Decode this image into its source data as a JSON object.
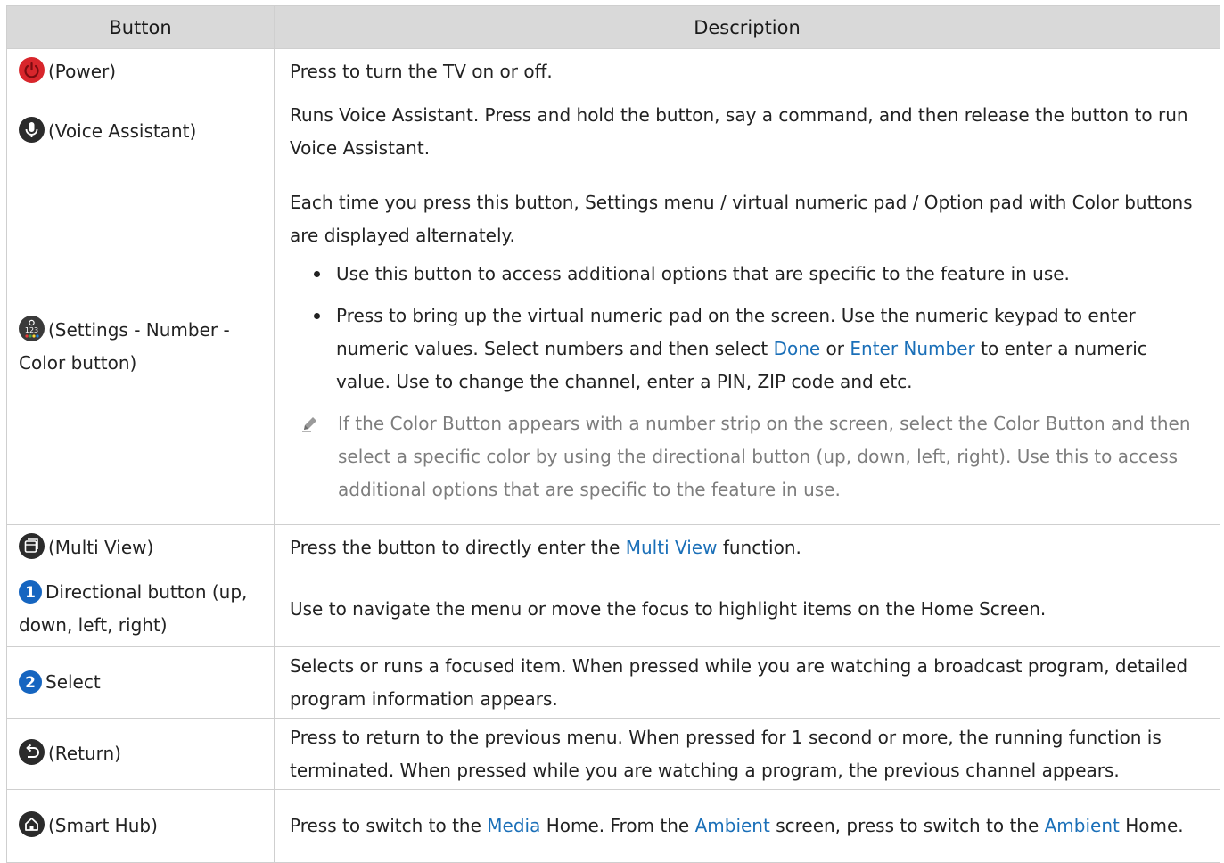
{
  "header": {
    "col_button": "Button",
    "col_description": "Description"
  },
  "rows": [
    {
      "button": "(Power)",
      "icon": "power-icon",
      "desc": "Press to turn the TV on or off."
    },
    {
      "button": "(Voice Assistant)",
      "icon": "microphone-icon",
      "desc": "Runs Voice Assistant. Press and hold the button, say a command, and then release the button to run Voice Assistant."
    },
    {
      "button": "(Settings - Number - Color button)",
      "icon": "settings-number-color-icon",
      "desc": "Each time you press this button, Settings menu / virtual numeric pad / Option pad with Color buttons are displayed alternately.",
      "bullet1": "Use this button to access additional options that are specific to the feature in use.",
      "bullet2_a": "Press to bring up the virtual numeric pad on the screen. Use the numeric keypad to enter numeric values. Select numbers and then select",
      "bullet2_link1": "Done",
      "bullet2_b": "or",
      "bullet2_link2": "Enter Number",
      "bullet2_c": "to enter a numeric value. Use to change the channel, enter a PIN, ZIP code and etc.",
      "note": "If the Color Button appears with a number strip on the screen, select the Color Button and then select a specific color by using the directional button (up, down, left, right). Use this to access additional options that are specific to the feature in use."
    },
    {
      "button": "(Multi View)",
      "icon": "multi-view-icon",
      "desc_a": "Press the button to directly enter the",
      "desc_link": "Multi View",
      "desc_b": "function."
    },
    {
      "badge": "1",
      "button": "Directional button (up, down, left, right)",
      "desc": "Use to navigate the menu or move the focus to highlight items on the Home Screen."
    },
    {
      "badge": "2",
      "button": "Select",
      "desc": "Selects or runs a focused item. When pressed while you are watching a broadcast program, detailed program information appears."
    },
    {
      "button": "(Return)",
      "icon": "return-icon",
      "desc": "Press to return to the previous menu. When pressed for 1 second or more, the running function is terminated. When pressed while you are watching a program, the previous channel appears."
    },
    {
      "button": "(Smart Hub)",
      "icon": "home-icon",
      "desc_a": "Press to switch to the",
      "desc_link1": "Media",
      "desc_b": "Home. From the",
      "desc_link2": "Ambient",
      "desc_c": "screen, press to switch to the",
      "desc_link3": "Ambient",
      "desc_d": "Home."
    }
  ],
  "colors": {
    "link": "#1a6fb8",
    "header_bg": "#d9d9d9",
    "power_red": "#d8262c",
    "badge_blue": "#1565c0"
  }
}
